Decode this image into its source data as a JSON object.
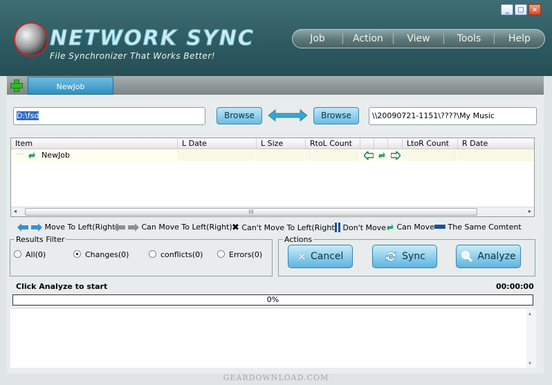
{
  "window": {
    "controls": [
      "_",
      "□",
      "×"
    ]
  },
  "logo": {
    "title": "NETWORK SYNC",
    "subtitle": "File Synchronizer That Works Better!"
  },
  "menu": [
    "Job",
    "Action",
    "View",
    "Tools",
    "Help"
  ],
  "tabs": [
    {
      "label": "NewJob"
    }
  ],
  "paths": {
    "left": "D:\\fsd",
    "right": "\\\\20090721-1151\\????\\My Music"
  },
  "browse_label": "Browse",
  "grid": {
    "columns": [
      "Item",
      "L Date",
      "L Size",
      "RtoL Count",
      "LtoR Count",
      "R Date"
    ],
    "rows": [
      {
        "item": "NewJob"
      }
    ],
    "scroll_mark": "III"
  },
  "legend": {
    "move": "Move To Left(Right)",
    "can_move": "Can Move To Left(Right)",
    "cant_move": "Can't Move To Left(Right)",
    "dont_move": "Don't Move",
    "can_move2": "Can Move",
    "same": "The Same Comtent"
  },
  "filter": {
    "title": "Results Filter",
    "options": [
      {
        "label": "All(0)",
        "selected": false
      },
      {
        "label": "Changes(0)",
        "selected": true
      },
      {
        "label": "conflicts(0)",
        "selected": false
      },
      {
        "label": "Errors(0)",
        "selected": false
      }
    ]
  },
  "actions": {
    "title": "Actions",
    "cancel": "Cancel",
    "sync": "Sync",
    "analyze": "Analyze"
  },
  "status": {
    "message": "Click Analyze to start",
    "time": "00:00:00",
    "progress_text": "0%",
    "progress": 0
  },
  "watermark": "GEARDOWNLOAD.COM",
  "colors": {
    "header": "#2f5c62",
    "accent": "#5db4df"
  }
}
